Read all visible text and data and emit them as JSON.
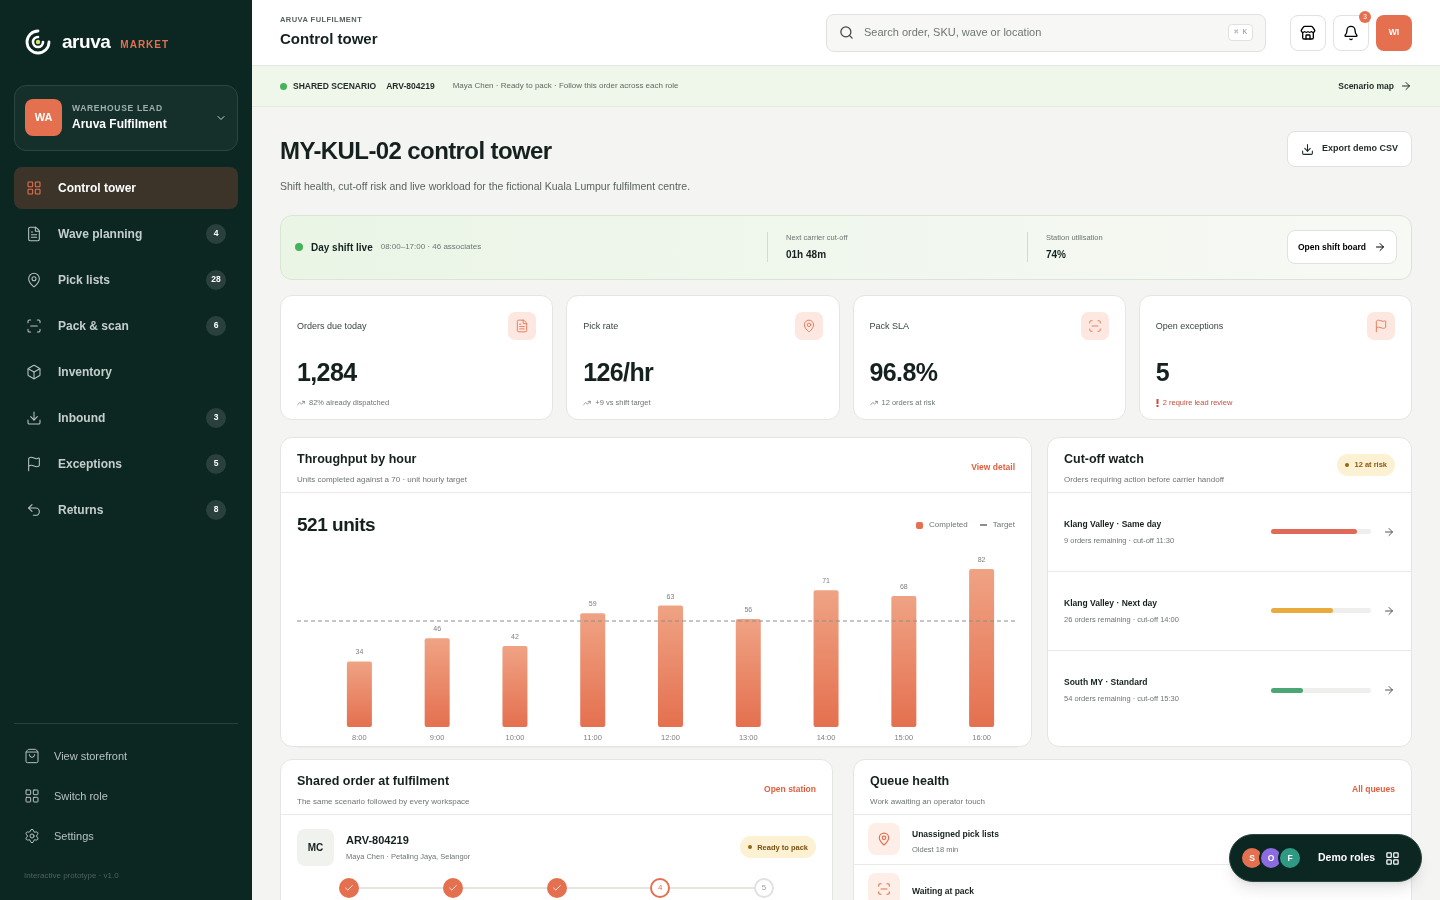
{
  "brand": {
    "name": "aruva",
    "tag": "MARKET"
  },
  "role": {
    "initials": "WA",
    "label": "WAREHOUSE LEAD",
    "name": "Aruva Fulfilment"
  },
  "nav": [
    {
      "label": "Control tower",
      "selected": true
    },
    {
      "label": "Wave planning",
      "selected": false,
      "count": "4"
    },
    {
      "label": "Pick lists",
      "selected": false,
      "count": "28"
    },
    {
      "label": "Pack & scan",
      "selected": false,
      "count": "6"
    },
    {
      "label": "Inventory",
      "selected": false
    },
    {
      "label": "Inbound",
      "selected": false,
      "count": "3"
    },
    {
      "label": "Exceptions",
      "selected": false,
      "count": "5"
    },
    {
      "label": "Returns",
      "selected": false,
      "count": "8"
    }
  ],
  "footer_nav": [
    "View storefront",
    "Switch role",
    "Settings"
  ],
  "version": "Interactive prototype · v1.0",
  "header": {
    "eyebrow": "ARUVA FULFILMENT",
    "title": "Control tower",
    "search_placeholder": "Search order, SKU, wave or location",
    "shortcut": "⌘ K",
    "notifications": "3",
    "user": "WI"
  },
  "banner": {
    "label": "SHARED SCENARIO",
    "order": "ARV-804219",
    "text": "Maya Chen · Ready to pack · Follow this order across each role",
    "link": "Scenario map"
  },
  "page": {
    "title": "MY-KUL-02 control tower",
    "subtitle": "Shift health, cut-off risk and live workload for the fictional Kuala Lumpur fulfilment centre.",
    "export": "Export demo CSV"
  },
  "shift": {
    "status": "Day shift live",
    "detail": "08:00–17:00 · 46 associates",
    "stats": [
      {
        "label": "Next carrier cut-off",
        "value": "01h 48m"
      },
      {
        "label": "Station utilisation",
        "value": "74%"
      }
    ],
    "button": "Open shift board"
  },
  "kpis": [
    {
      "label": "Orders due today",
      "value": "1,284",
      "note": "82% already dispatched",
      "kind": "trend"
    },
    {
      "label": "Pick rate",
      "value": "126/hr",
      "note": "+9 vs shift target",
      "kind": "trend"
    },
    {
      "label": "Pack SLA",
      "value": "96.8%",
      "note": "12 orders at risk",
      "kind": "trend"
    },
    {
      "label": "Open exceptions",
      "value": "5",
      "note": "2 require lead review",
      "kind": "alert"
    }
  ],
  "throughput": {
    "title": "Throughput by hour",
    "subtitle": "Units completed against a 70 · unit hourly target",
    "link": "View detail",
    "total": "521 units",
    "chart_data": {
      "type": "bar",
      "categories": [
        "8:00",
        "9:00",
        "10:00",
        "11:00",
        "12:00",
        "13:00",
        "14:00",
        "15:00",
        "16:00"
      ],
      "series": [
        {
          "name": "Completed",
          "color": "#e4704f",
          "values": [
            34,
            46,
            42,
            59,
            63,
            56,
            71,
            68,
            82
          ]
        }
      ],
      "data_labels": true
    },
    "target_label": "Target"
  },
  "cutoff": {
    "title": "Cut-off watch",
    "subtitle": "Orders requiring action before carrier handoff",
    "badge": "12 at risk",
    "rows": [
      {
        "name": "Klang Valley · Same day",
        "detail": "9 orders remaining · cut-off 11:30",
        "level": 0.86,
        "color": "#e06a57"
      },
      {
        "name": "Klang Valley · Next day",
        "detail": "26 orders remaining · cut-off 14:00",
        "level": 0.62,
        "color": "#e9ac3c"
      },
      {
        "name": "South MY · Standard",
        "detail": "54 orders remaining · cut-off 15:30",
        "level": 0.32,
        "color": "#4aa674"
      }
    ]
  },
  "shared_order": {
    "title": "Shared order at fulfilment",
    "subtitle": "The same scenario followed by every workspace",
    "link": "Open station",
    "initials": "MC",
    "order": "ARV-804219",
    "customer": "Maya Chen · Petaling Jaya, Selangor",
    "status": "Ready to pack",
    "steps": [
      {
        "done": true,
        "current": false
      },
      {
        "done": true,
        "current": false
      },
      {
        "done": true,
        "current": false
      },
      {
        "done": false,
        "current": true,
        "label": "4"
      },
      {
        "done": false,
        "current": false,
        "label": "5"
      }
    ]
  },
  "queue": {
    "title": "Queue health",
    "subtitle": "Work awaiting an operator touch",
    "link": "All queues",
    "rows": [
      {
        "name": "Unassigned pick lists",
        "detail": "Oldest 18 min"
      },
      {
        "name": "Waiting at pack"
      }
    ]
  },
  "demo": {
    "label": "Demo roles",
    "avatars": [
      {
        "letter": "S",
        "color": "#e4704f"
      },
      {
        "letter": "O",
        "color": "#8a6be0"
      },
      {
        "letter": "F",
        "color": "#2f9a84"
      }
    ]
  }
}
